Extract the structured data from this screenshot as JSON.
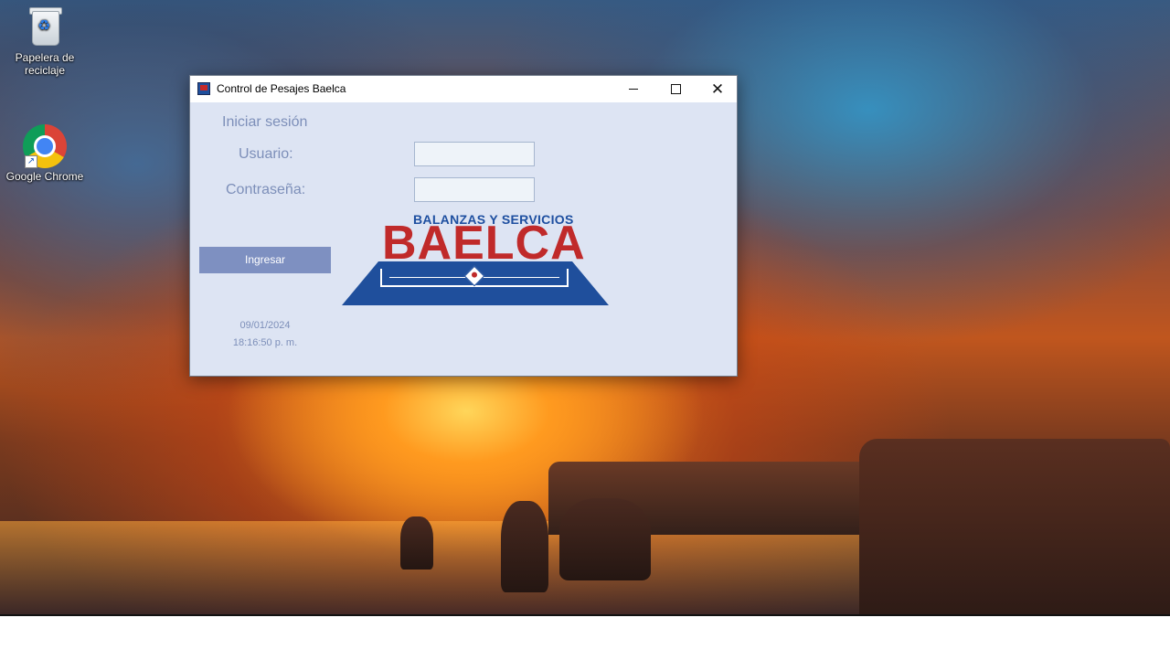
{
  "desktop": {
    "icons": [
      {
        "label": "Papelera de reciclaje",
        "icon": "recycle-bin-icon"
      },
      {
        "label": "Google Chrome",
        "icon": "chrome-icon"
      }
    ]
  },
  "window": {
    "title": "Control de Pesajes Baelca",
    "app_icon": "baelca-app-icon",
    "controls": {
      "minimize": "minimize-icon",
      "maximize": "maximize-icon",
      "close": "close-icon"
    }
  },
  "login": {
    "heading": "Iniciar sesión",
    "user_label": "Usuario:",
    "user_value": "",
    "password_label": "Contraseña:",
    "password_value": "",
    "submit_label": "Ingresar",
    "date": "09/01/2024",
    "time": "18:16:50 p. m."
  },
  "logo": {
    "tagline": "BALANZAS Y SERVICIOS",
    "brand": "BAELCA",
    "colors": {
      "red": "#c02a2a",
      "blue": "#1f4f9c"
    }
  },
  "colors": {
    "window_bg": "#dde4f3",
    "label_text": "#7d8fb9",
    "button_bg": "#7e90c1"
  }
}
